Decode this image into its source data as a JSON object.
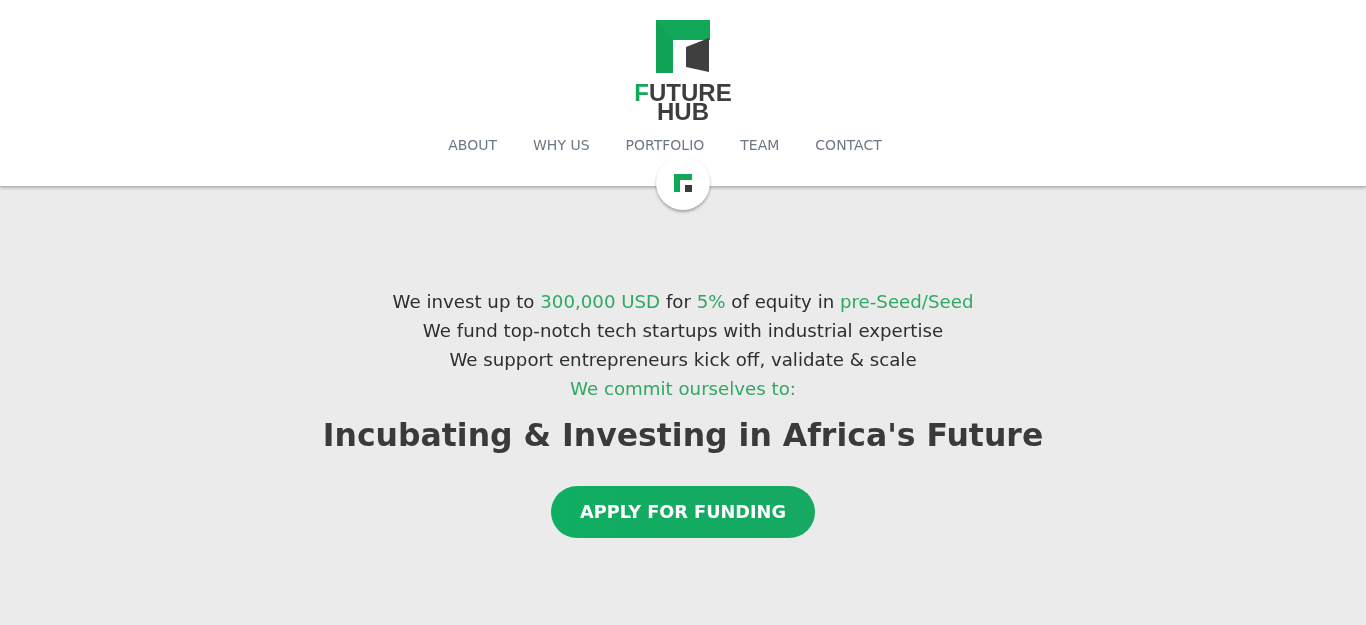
{
  "header": {
    "logo": {
      "line_1": "FUTURE",
      "line_2": "HUB"
    },
    "nav": [
      {
        "label": "ABOUT"
      },
      {
        "label": "WHY US"
      },
      {
        "label": "PORTFOLIO"
      },
      {
        "label": "TEAM"
      },
      {
        "label": "CONTACT"
      }
    ]
  },
  "hero": {
    "lines": [
      {
        "segments": [
          {
            "text": "We invest up to ",
            "highlight": false
          },
          {
            "text": "300,000 USD",
            "highlight": true
          },
          {
            "text": " for ",
            "highlight": false
          },
          {
            "text": "5%",
            "highlight": true
          },
          {
            "text": " of equity in ",
            "highlight": false
          },
          {
            "text": "pre-Seed/Seed",
            "highlight": true
          }
        ]
      },
      {
        "segments": [
          {
            "text": "We fund top-notch tech startups with industrial expertise",
            "highlight": false
          }
        ]
      },
      {
        "segments": [
          {
            "text": "We support entrepreneurs kick off, validate & scale",
            "highlight": false
          }
        ]
      },
      {
        "segments": [
          {
            "text": "We commit ourselves to:",
            "highlight": true
          }
        ]
      }
    ],
    "headline": "Incubating & Investing in Africa's Future",
    "cta": "APPLY FOR FUNDING"
  }
}
